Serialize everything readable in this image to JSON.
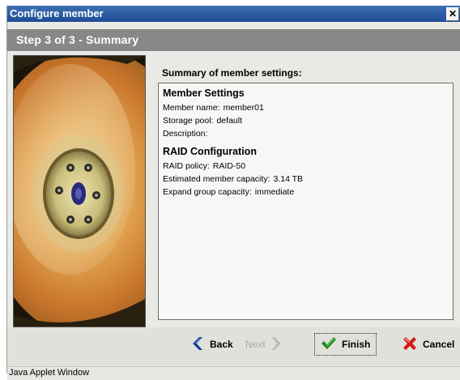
{
  "window": {
    "title": "Configure member",
    "close_glyph": "✕",
    "status_text": "Java Applet Window"
  },
  "wizard": {
    "step_label": "Step 3 of 3 - Summary"
  },
  "summary": {
    "heading": "Summary of member settings:",
    "member_settings": {
      "title": "Member Settings",
      "rows": [
        {
          "label": "Member name:",
          "value": "member01"
        },
        {
          "label": "Storage pool:",
          "value": "default"
        },
        {
          "label": "Description:",
          "value": ""
        }
      ]
    },
    "raid_configuration": {
      "title": "RAID Configuration",
      "rows": [
        {
          "label": "RAID policy:",
          "value": "RAID-50"
        },
        {
          "label": "Estimated member capacity:",
          "value": "3.14 TB"
        },
        {
          "label": "Expand group capacity:",
          "value": "immediate"
        }
      ]
    }
  },
  "buttons": {
    "back": {
      "label": "Back",
      "icon": "back-chevron-icon",
      "color": "#1c3f94"
    },
    "next": {
      "label": "Next",
      "icon": "next-chevron-icon",
      "color": "#b9b9b9"
    },
    "finish": {
      "label": "Finish",
      "icon": "checkmark-icon",
      "color": "#1f8a1f"
    },
    "cancel": {
      "label": "Cancel",
      "icon": "cancel-x-icon",
      "color": "#d11a1a"
    }
  },
  "colors": {
    "titlebar": "#1e4c95",
    "stepbar": "#888888"
  }
}
